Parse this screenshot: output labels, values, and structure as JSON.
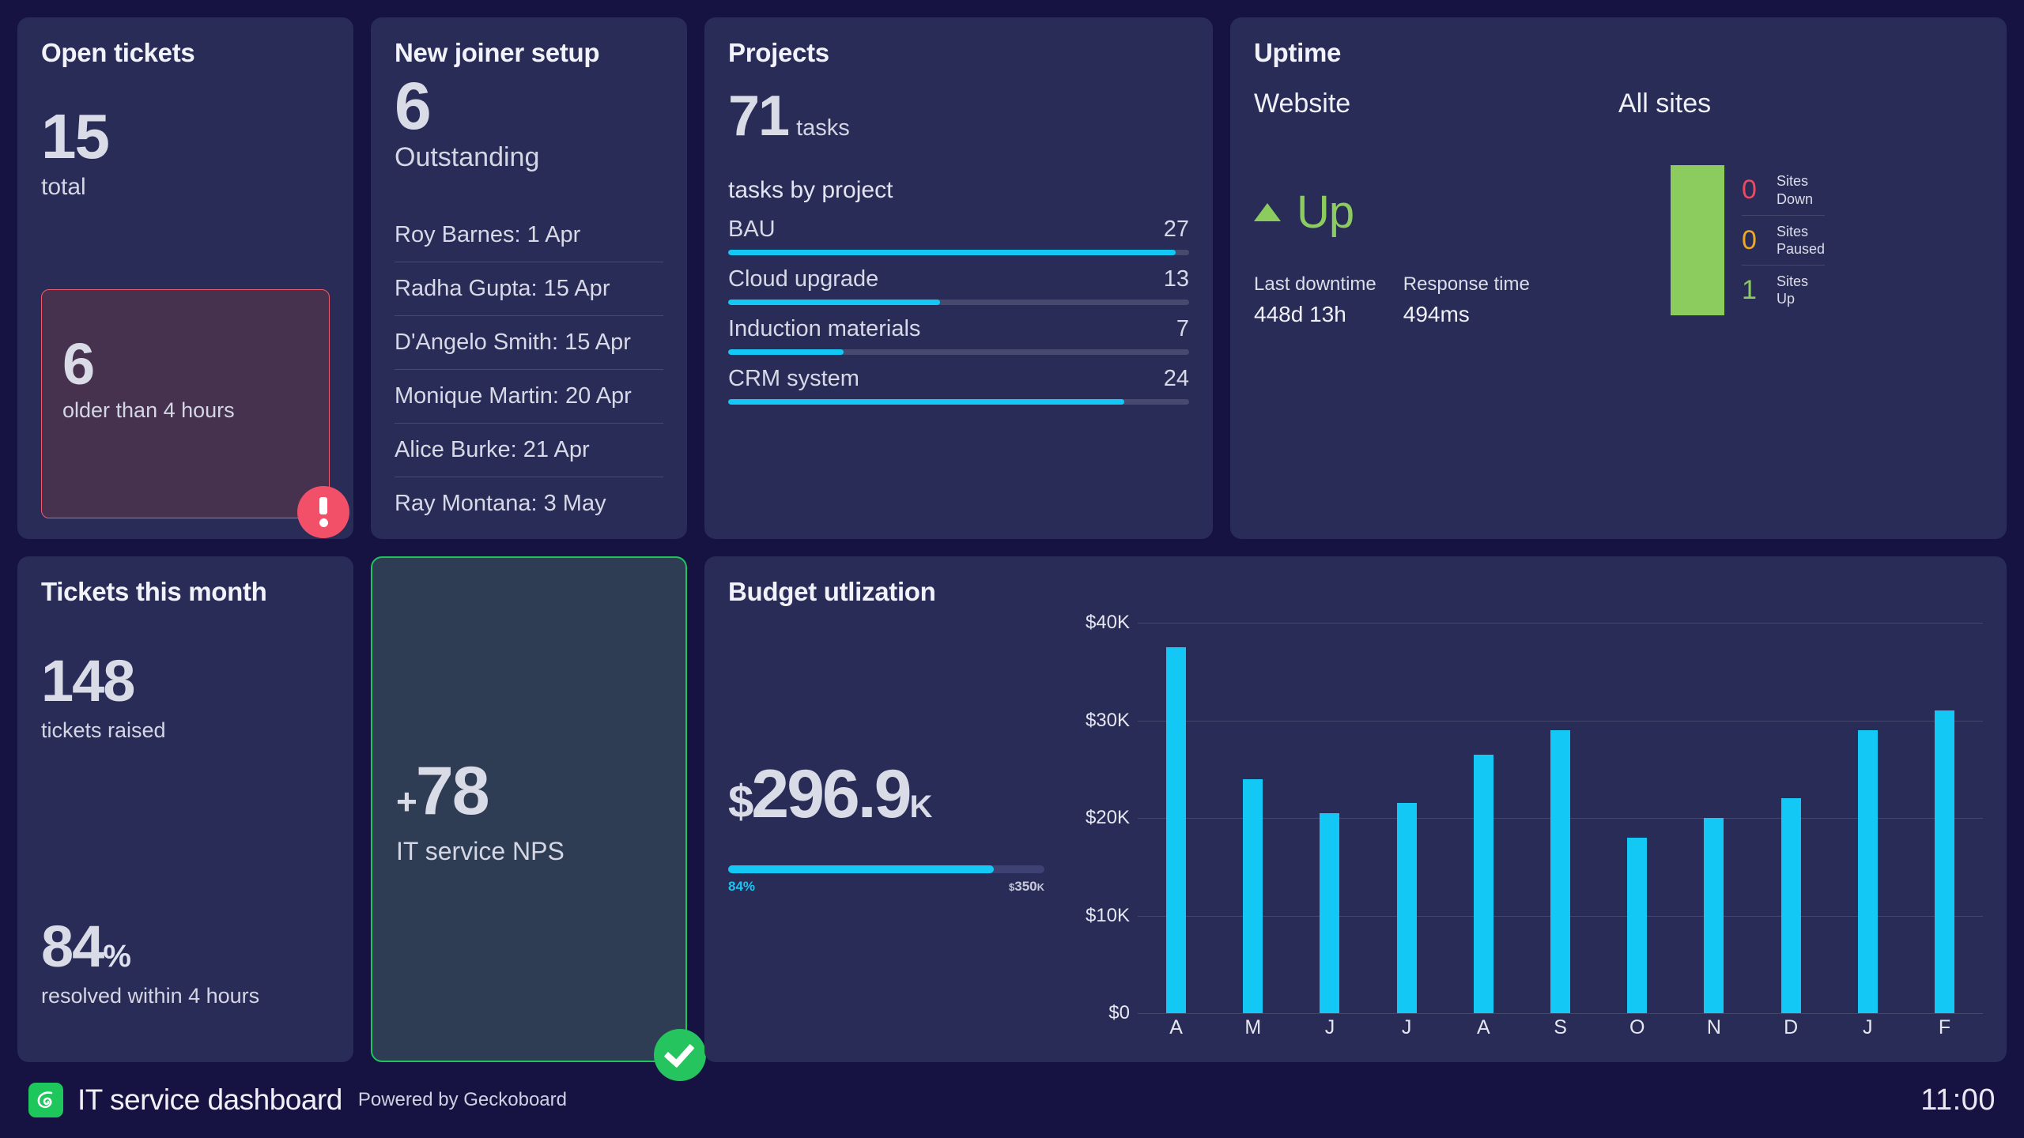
{
  "open_tickets": {
    "title": "Open tickets",
    "total_value": "15",
    "total_label": "total",
    "alert_value": "6",
    "alert_label": "older than 4 hours",
    "alert_icon": "exclamation-icon",
    "alert_border_color": "#f05a6e",
    "alert_bg_color": "#46324f"
  },
  "tickets_month": {
    "title": "Tickets this month",
    "raised_value": "148",
    "raised_label": "tickets raised",
    "resolved_value": "84",
    "resolved_unit": "%",
    "resolved_label": "resolved within 4 hours"
  },
  "new_joiner": {
    "title": "New joiner setup",
    "count": "6",
    "count_label": "Outstanding",
    "rows": [
      "Roy Barnes: 1 Apr",
      "Radha Gupta: 15 Apr",
      "D'Angelo Smith: 15 Apr",
      "Monique Martin: 20 Apr",
      "Alice Burke: 21 Apr",
      "Ray Montana: 3 May"
    ]
  },
  "nps": {
    "sign": "+",
    "value": "78",
    "label": "IT service NPS",
    "status_icon": "check-icon",
    "border_color": "#1fc55c",
    "bg_color": "#2e3d53"
  },
  "projects": {
    "title": "Projects",
    "total_value": "71",
    "total_unit": "tasks",
    "subtitle": "tasks by project",
    "bar_color": "#13c8f5",
    "rows": [
      {
        "label": "BAU",
        "value": "27",
        "pct": 97
      },
      {
        "label": "Cloud upgrade",
        "value": "13",
        "pct": 46
      },
      {
        "label": "Induction materials",
        "value": "7",
        "pct": 25
      },
      {
        "label": "CRM system",
        "value": "24",
        "pct": 86
      }
    ]
  },
  "uptime": {
    "title": "Uptime",
    "website": {
      "heading": "Website",
      "status": "Up",
      "status_icon": "triangle-up-icon",
      "status_color": "#8ccb5e",
      "last_downtime_label": "Last downtime",
      "last_downtime_value": "448d 13h",
      "response_label": "Response time",
      "response_value": "494ms"
    },
    "all_sites": {
      "heading": "All sites",
      "bar_color": "#8ccb5e",
      "legend": [
        {
          "count": "0",
          "line1": "Sites",
          "line2": "Down",
          "color": "#f0485f"
        },
        {
          "count": "0",
          "line1": "Sites",
          "line2": "Paused",
          "color": "#f0a820"
        },
        {
          "count": "1",
          "line1": "Sites",
          "line2": "Up",
          "color": "#8ccb5e"
        }
      ]
    }
  },
  "budget": {
    "title": "Budget utlization",
    "currency": "$",
    "amount": "296.9",
    "scale": "K",
    "progress_pct_label": "84%",
    "progress_pct": 84,
    "target_label": "$350ĸ",
    "target_prefix": "$",
    "target_value": "350",
    "target_scale": "K",
    "accent": "#13c8f5"
  },
  "chart_data": {
    "type": "bar",
    "title": "Budget utlization",
    "xlabel": "",
    "ylabel": "",
    "categories": [
      "A",
      "M",
      "J",
      "J",
      "A",
      "S",
      "O",
      "N",
      "D",
      "J",
      "F"
    ],
    "values": [
      37500,
      24000,
      20500,
      21500,
      26500,
      29000,
      18000,
      20000,
      22000,
      29000,
      31000
    ],
    "tick_labels": [
      "$0",
      "$10K",
      "$20K",
      "$30K",
      "$40K"
    ],
    "ticks": [
      0,
      10000,
      20000,
      30000,
      40000
    ],
    "ylim": [
      0,
      40000
    ],
    "grid": true,
    "legend": false,
    "bar_color": "#13c8f5"
  },
  "footer": {
    "logo_icon": "geckoboard-logo-icon",
    "title": "IT service dashboard",
    "powered_by": "Powered by Geckoboard",
    "clock": "11:00"
  }
}
